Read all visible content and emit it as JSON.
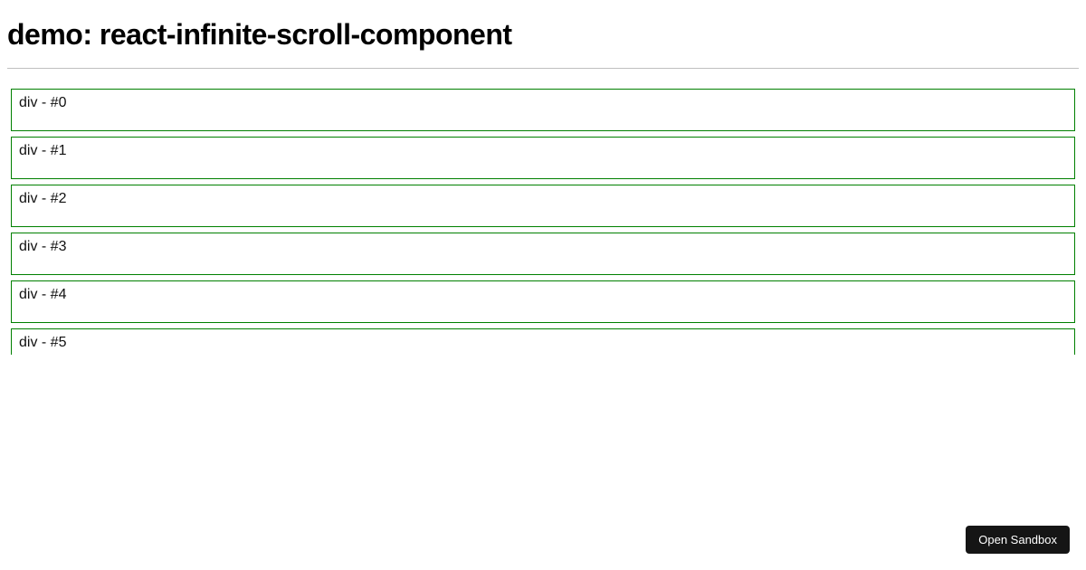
{
  "header": {
    "title": "demo: react-infinite-scroll-component"
  },
  "list": {
    "items": [
      {
        "label": "div - #0"
      },
      {
        "label": "div - #1"
      },
      {
        "label": "div - #2"
      },
      {
        "label": "div - #3"
      },
      {
        "label": "div - #4"
      },
      {
        "label": "div - #5"
      }
    ]
  },
  "actions": {
    "open_sandbox_label": "Open Sandbox"
  },
  "colors": {
    "item_border": "#008000",
    "button_bg": "#151515",
    "button_text": "#ffffff"
  }
}
